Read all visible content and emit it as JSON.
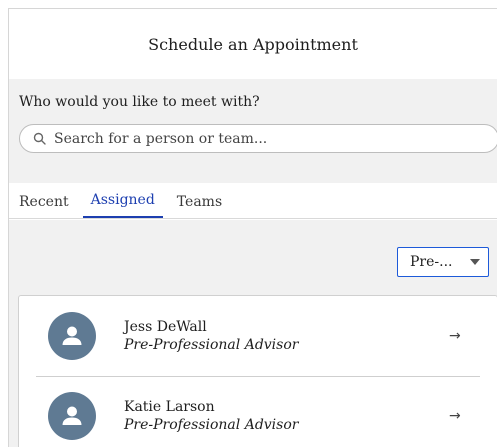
{
  "header": {
    "title": "Schedule an Appointment"
  },
  "prompt": {
    "label": "Who would you like to meet with?",
    "search_placeholder": "Search for a person or team..."
  },
  "tabs": [
    {
      "label": "Recent",
      "active": false
    },
    {
      "label": "Assigned",
      "active": true
    },
    {
      "label": "Teams",
      "active": false
    }
  ],
  "filter": {
    "selected": "Pre-..."
  },
  "people": [
    {
      "name": "Jess DeWall",
      "role": "Pre-Professional Advisor",
      "avatar_icon": "user-icon",
      "action_icon": "arrow-right-icon"
    },
    {
      "name": "Katie Larson",
      "role": "Pre-Professional Advisor",
      "avatar_icon": "user-icon",
      "action_icon": "arrow-right-icon"
    }
  ],
  "colors": {
    "accent": "#1d3fb0",
    "avatar": "#5f7a93",
    "panel_bg": "#f1f1f1"
  }
}
